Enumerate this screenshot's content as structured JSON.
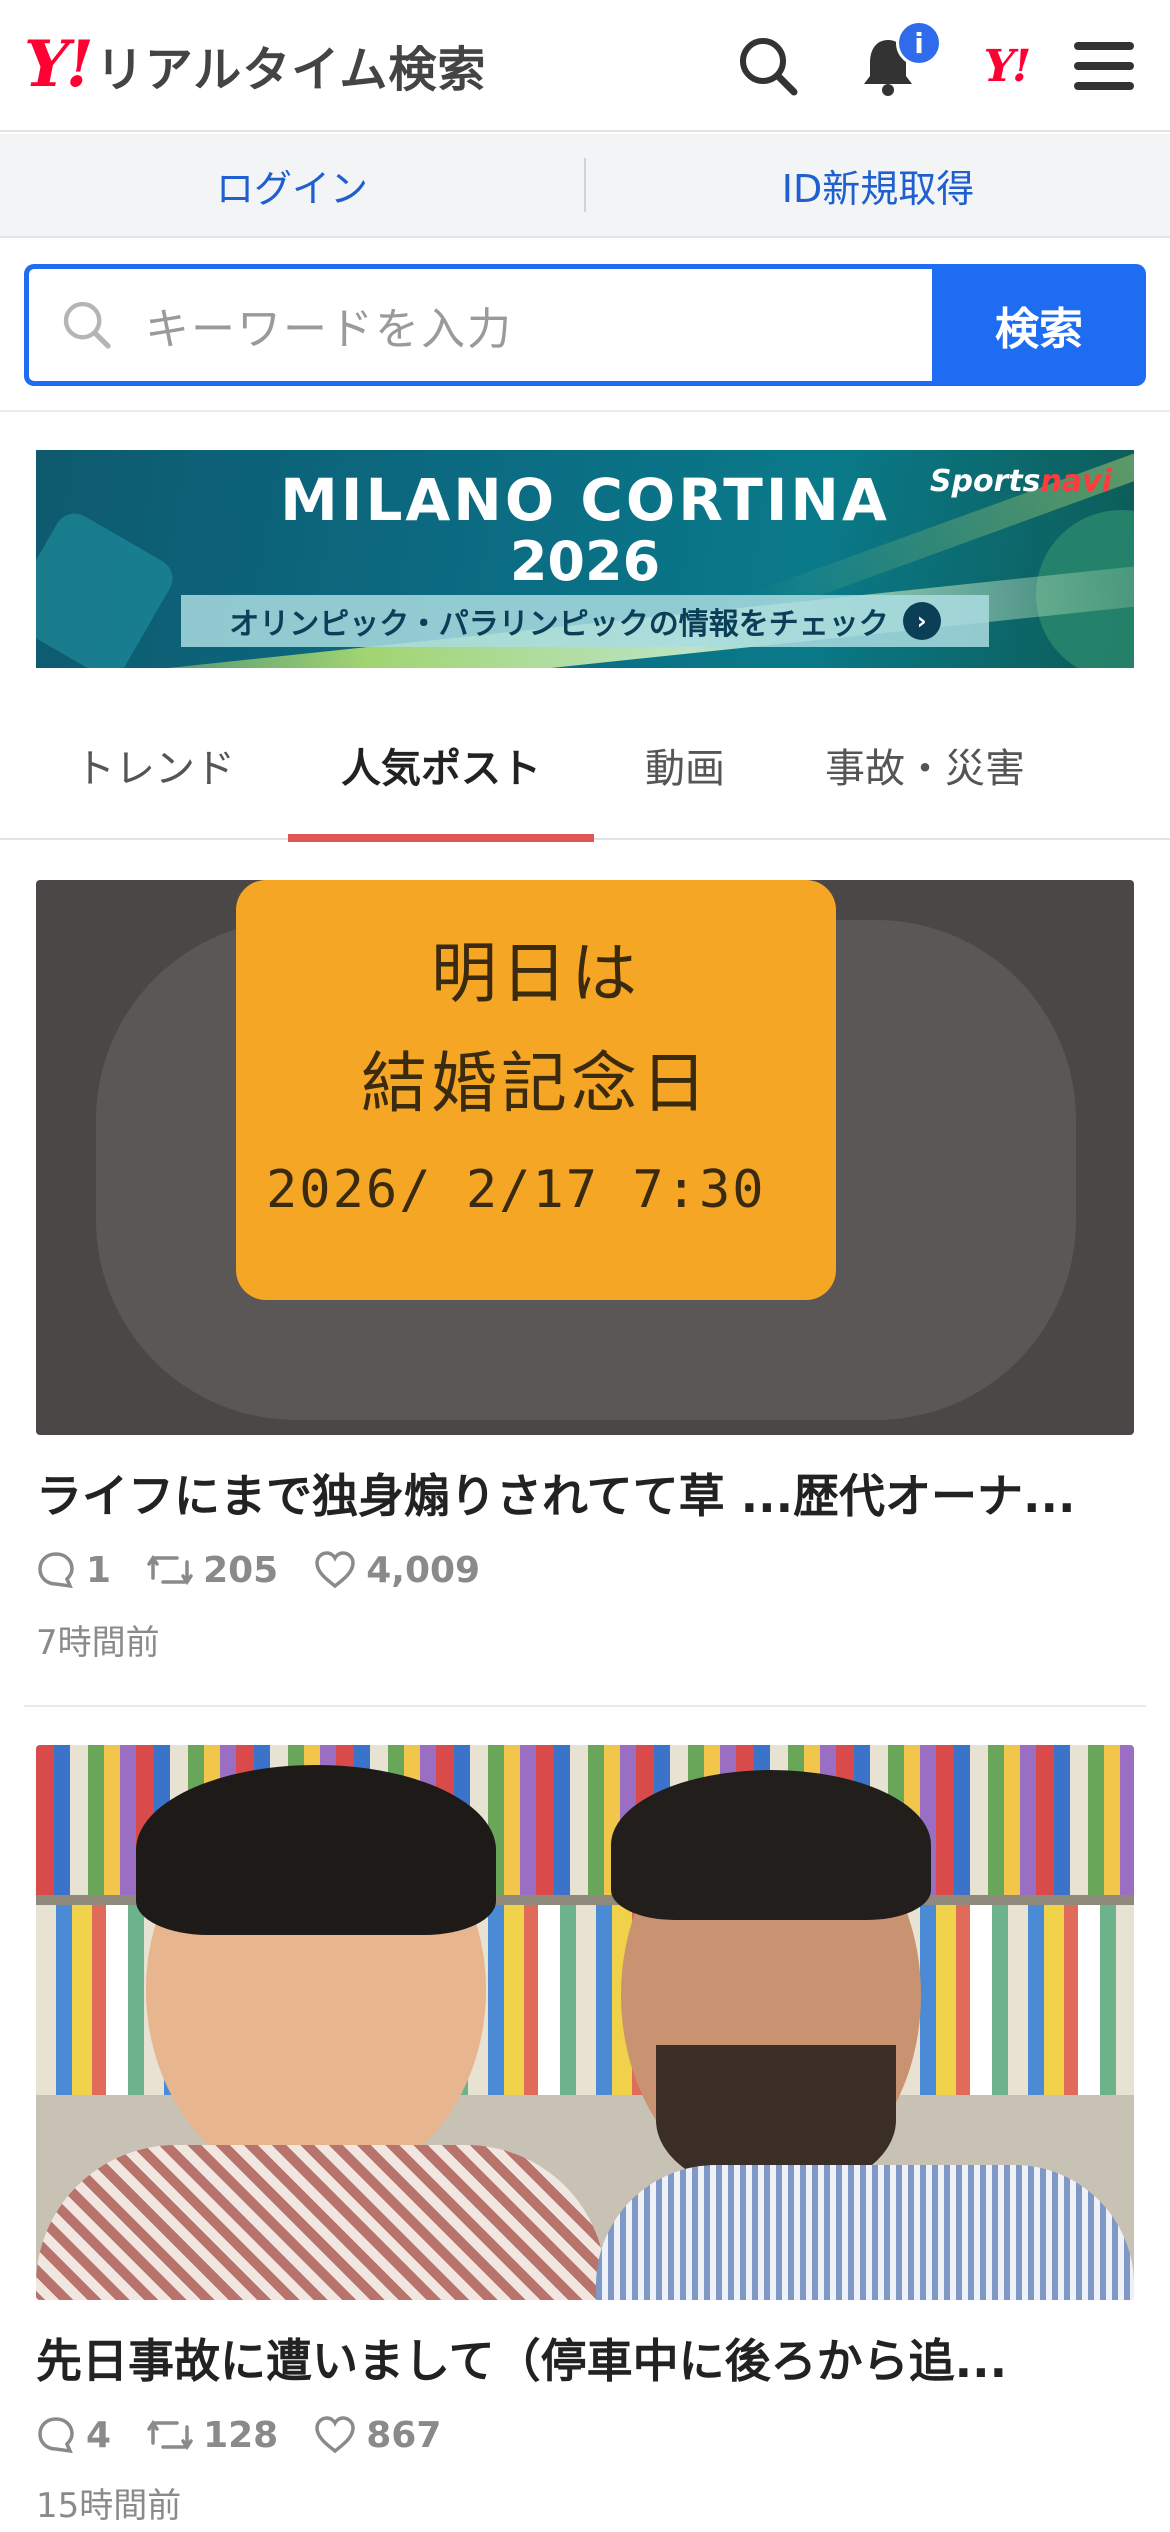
{
  "header": {
    "logo_mark": "Y!",
    "logo_text": "リアルタイム検索",
    "notification_badge": "i",
    "yj_mark": "Y!"
  },
  "auth": {
    "login": "ログイン",
    "register": "ID新規取得"
  },
  "search": {
    "placeholder": "キーワードを入力",
    "button": "検索"
  },
  "banner": {
    "title": "MILANO CORTINA",
    "year": "2026",
    "cta": "オリンピック・パラリンピックの情報をチェック",
    "brand_a": "Sports",
    "brand_b": "navi"
  },
  "tabs": [
    {
      "label": "トレンド",
      "active": false
    },
    {
      "label": "人気ポスト",
      "active": true
    },
    {
      "label": "動画",
      "active": false
    },
    {
      "label": "事故・災害",
      "active": false
    }
  ],
  "posts": [
    {
      "title": "ライフにまで独身煽りされてて草 ...歴代オーナ...",
      "replies": "1",
      "reposts": "205",
      "likes": "4,009",
      "time": "7時間前",
      "image_text": {
        "line1": "明日は",
        "line2": "結婚記念日",
        "line3": "2026/ 2/17   7:30"
      }
    },
    {
      "title": "先日事故に遭いまして（停車中に後ろから追...",
      "replies": "4",
      "reposts": "128",
      "likes": "867",
      "time": "15時間前"
    }
  ]
}
